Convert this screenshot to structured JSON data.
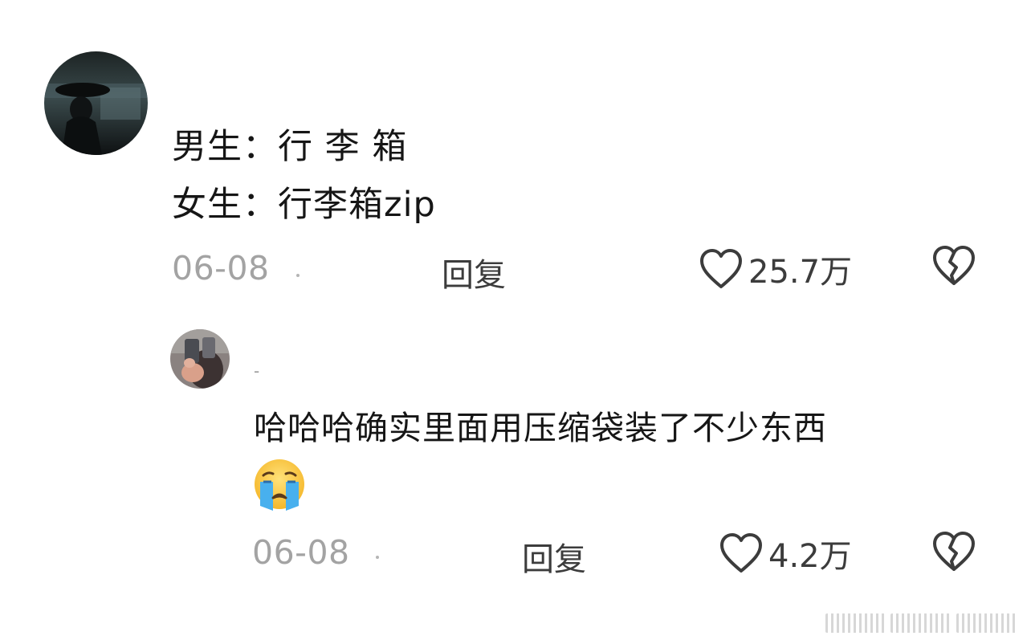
{
  "comments": [
    {
      "avatar": "dark-scene-avatar",
      "lines": [
        "男生：行 李 箱",
        "女生：行李箱zip"
      ],
      "date": "06-08",
      "reply_label": "回复",
      "like_count": "25.7万"
    },
    {
      "avatar": "selfie-avatar",
      "username": "-",
      "lines": [
        "哈哈哈确实里面用压缩袋装了不少东西"
      ],
      "emoji": "crying-face-emoji",
      "date": "06-08",
      "reply_label": "回复",
      "like_count": "4.2万"
    }
  ],
  "icons": {
    "like": "heart-outline-icon",
    "dislike": "broken-heart-icon"
  },
  "colors": {
    "text": "#161616",
    "meta": "#a3a3a3",
    "action": "#3c3c3c"
  }
}
